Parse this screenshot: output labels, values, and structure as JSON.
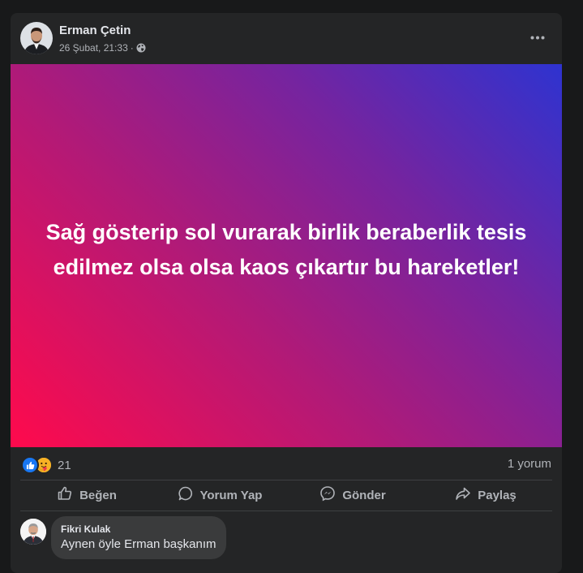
{
  "post": {
    "author": "Erman Çetin",
    "date": "26 Şubat, 21:33",
    "separator": "·",
    "privacy_icon": "globe-icon",
    "more_icon": "more-options-icon",
    "banner": {
      "text": "Sağ gösterip sol vurarak birlik beraberlik tesis edilmez olsa olsa kaos çıkartır bu hareketler!",
      "gradient_colors": [
        "#ff0a4c",
        "#b01a78",
        "#7424a0",
        "#2e33d0"
      ]
    },
    "reactions": {
      "icons": [
        "like-reaction-icon",
        "care-reaction-icon"
      ],
      "count": "21"
    },
    "comment_count": "1 yorum"
  },
  "actions": [
    {
      "label": "Beğen",
      "icon": "like-icon"
    },
    {
      "label": "Yorum Yap",
      "icon": "comment-icon"
    },
    {
      "label": "Gönder",
      "icon": "messenger-icon"
    },
    {
      "label": "Paylaş",
      "icon": "share-icon"
    }
  ],
  "comments": [
    {
      "author": "Fikri Kulak",
      "text": "Aynen öyle Erman başkanım"
    }
  ],
  "colors": {
    "background": "#18191a",
    "card": "#242526",
    "bubble": "#3a3b3c",
    "primary_text": "#e4e6eb",
    "secondary_text": "#b0b3b8",
    "like_blue": "#1877f2"
  }
}
